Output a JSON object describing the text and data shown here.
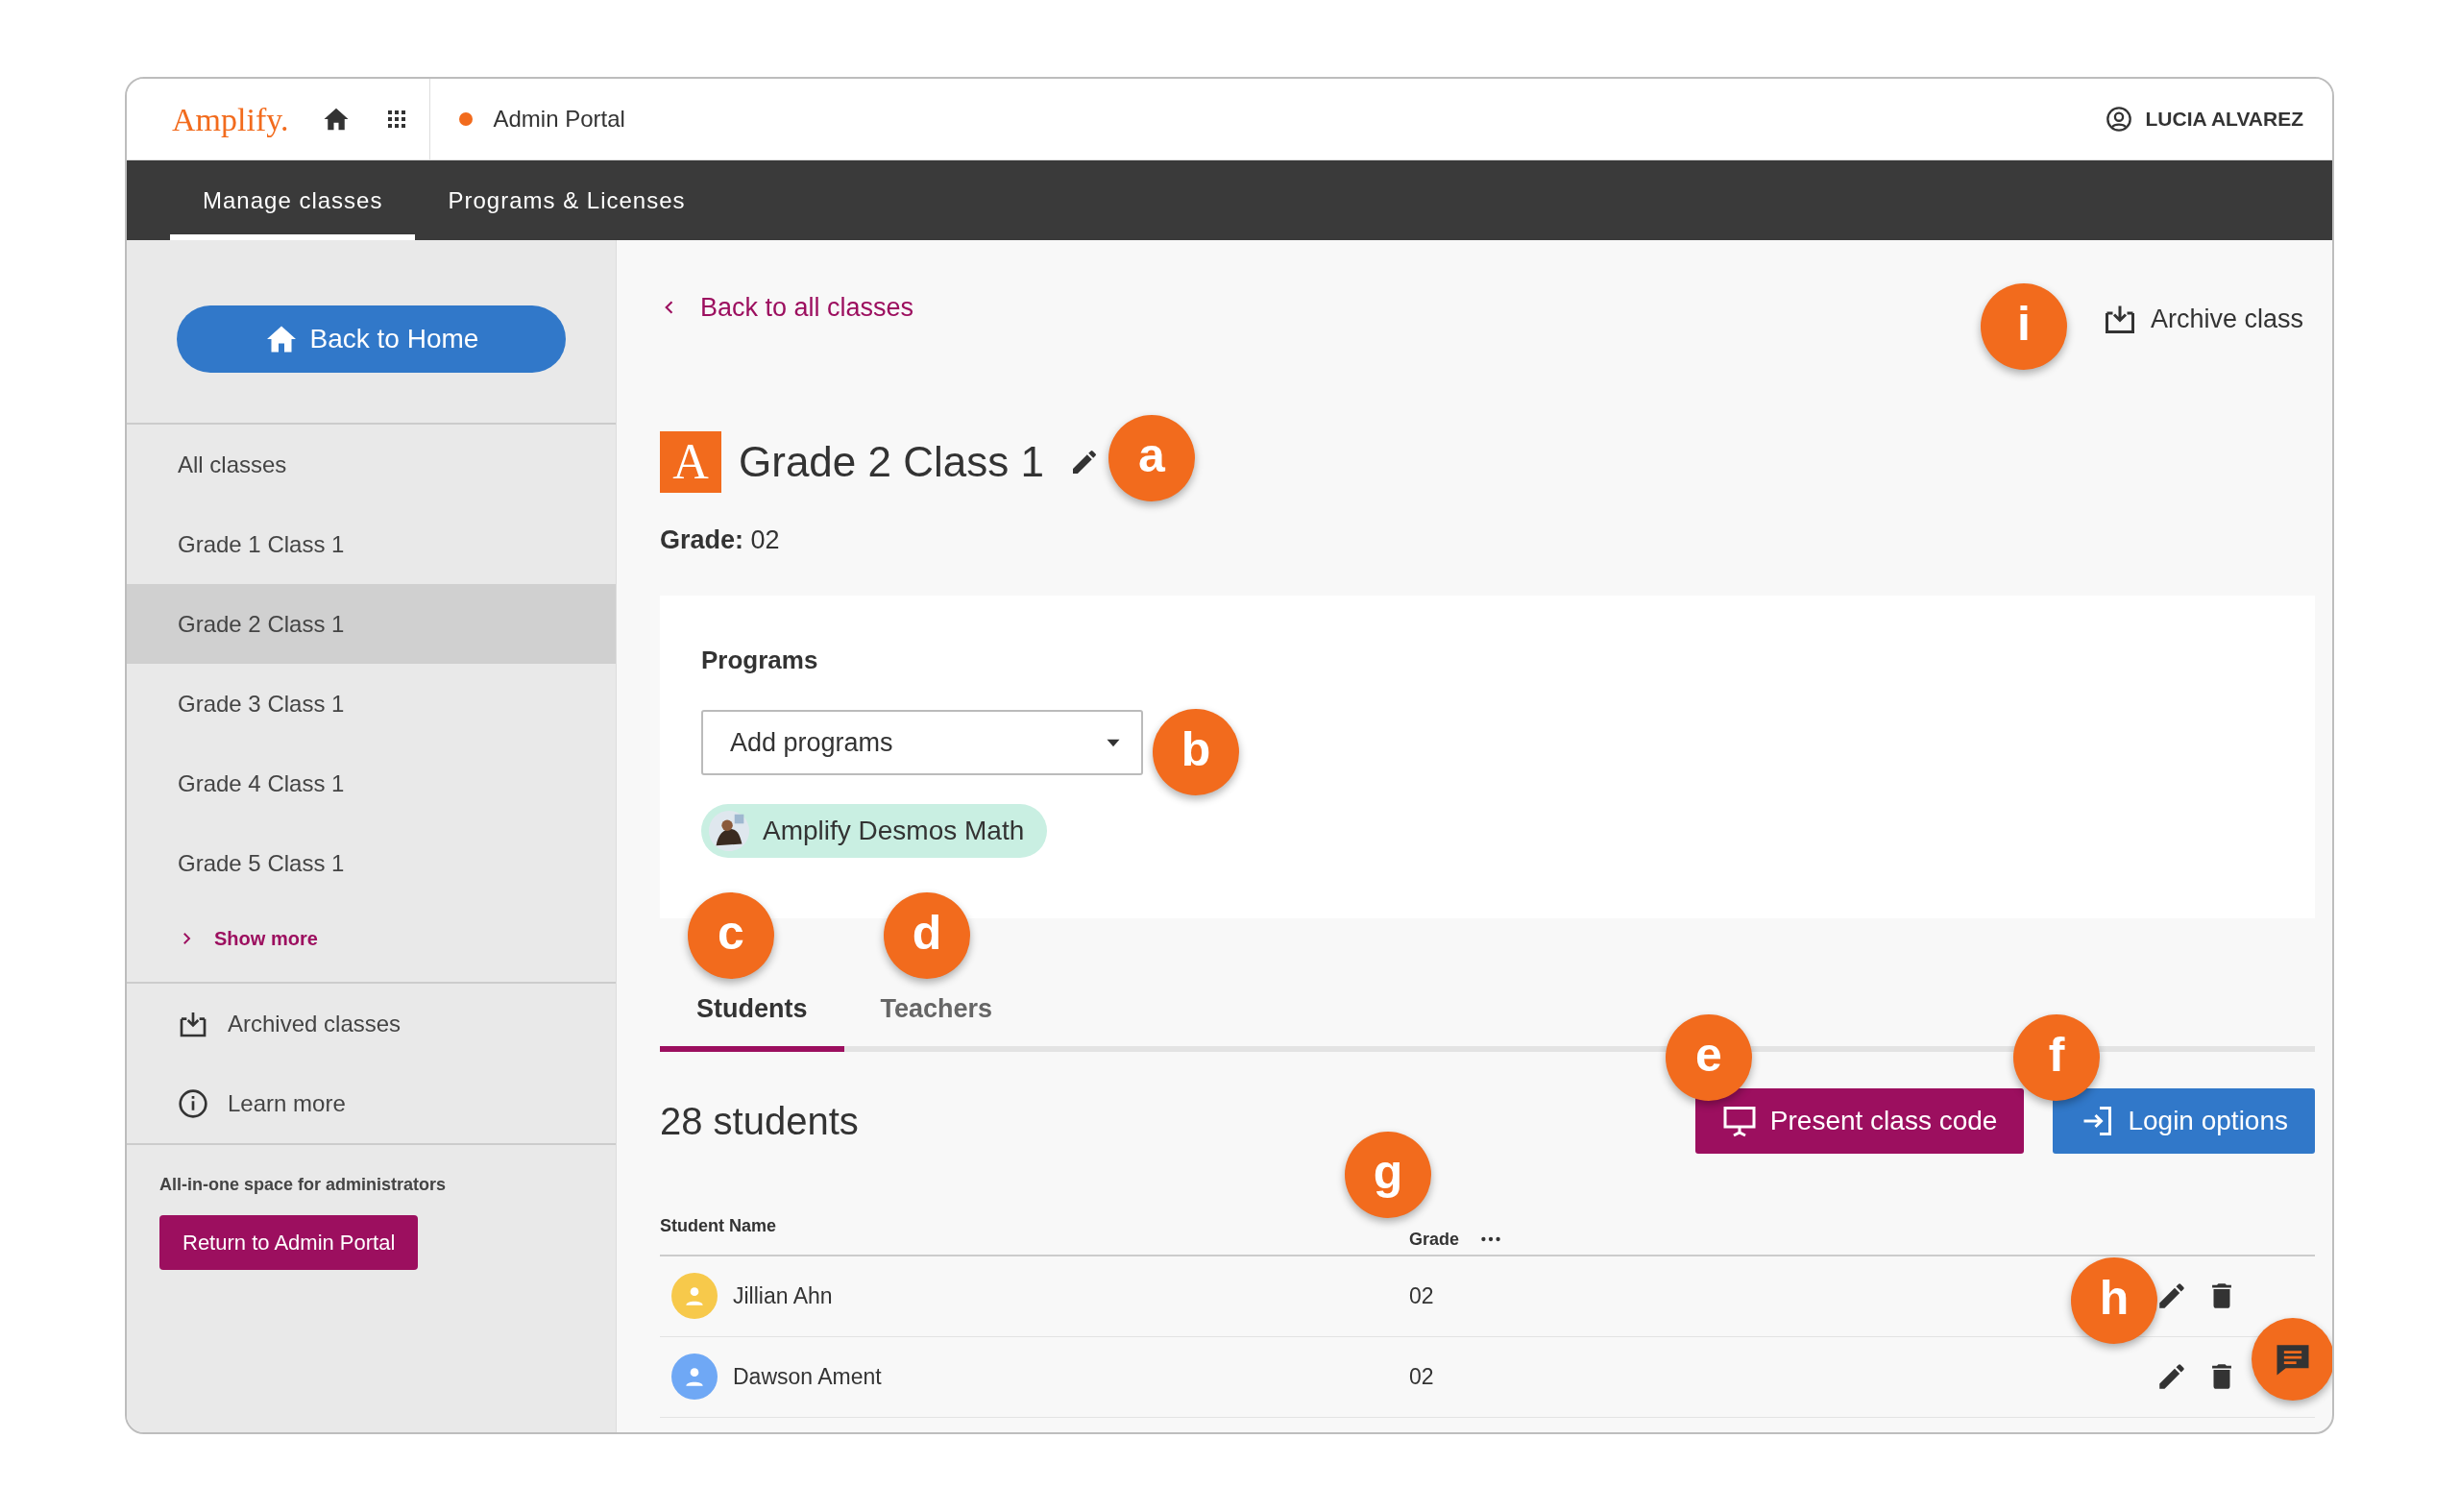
{
  "app": {
    "logo": "Amplify.",
    "portal": "Admin Portal",
    "user": "LUCIA ALVAREZ"
  },
  "nav_tabs": [
    {
      "label": "Manage classes",
      "selected": true
    },
    {
      "label": "Programs & Licenses",
      "selected": false
    }
  ],
  "sidebar": {
    "home_button": "Back to Home",
    "classes": [
      {
        "label": "All classes",
        "selected": false
      },
      {
        "label": "Grade 1 Class 1",
        "selected": false
      },
      {
        "label": "Grade 2 Class 1",
        "selected": true
      },
      {
        "label": "Grade 3 Class 1",
        "selected": false
      },
      {
        "label": "Grade 4 Class 1",
        "selected": false
      },
      {
        "label": "Grade 5 Class 1",
        "selected": false
      }
    ],
    "show_more": "Show more",
    "links": [
      {
        "label": "Archived classes",
        "kind": "archive"
      },
      {
        "label": "Learn more",
        "kind": "info"
      }
    ],
    "footer_text": "All-in-one space for administrators",
    "admin_button": "Return to Admin Portal"
  },
  "main": {
    "back_link": "Back to all classes",
    "archive_button": "Archive class",
    "class_logo": "A",
    "class_name": "Grade 2 Class 1",
    "grade_label": "Grade:",
    "grade_value": "02",
    "programs": {
      "title": "Programs",
      "placeholder": "Add programs",
      "chips": [
        "Amplify Desmos Math"
      ]
    },
    "tabs": [
      {
        "label": "Students",
        "selected": true
      },
      {
        "label": "Teachers",
        "selected": false
      }
    ],
    "count": "28 students",
    "present_button": "Present class code",
    "login_button": "Login options",
    "columns": [
      "Student Name",
      "Grade"
    ],
    "students": [
      {
        "name": "Jillian Ahn",
        "grade": "02",
        "color": "#f7c94b"
      },
      {
        "name": "Dawson Ament",
        "grade": "02",
        "color": "#6fa8f5"
      }
    ]
  },
  "callouts": [
    "a",
    "b",
    "c",
    "d",
    "e",
    "f",
    "g",
    "h",
    "i"
  ]
}
